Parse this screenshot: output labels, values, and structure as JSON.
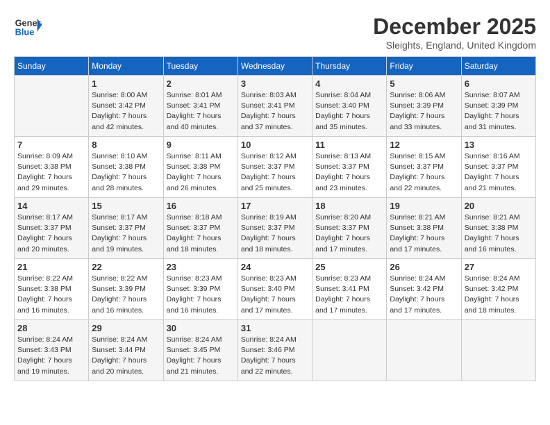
{
  "header": {
    "logo_general": "General",
    "logo_blue": "Blue",
    "month_title": "December 2025",
    "location": "Sleights, England, United Kingdom"
  },
  "days_of_week": [
    "Sunday",
    "Monday",
    "Tuesday",
    "Wednesday",
    "Thursday",
    "Friday",
    "Saturday"
  ],
  "weeks": [
    {
      "days": [
        {
          "number": "",
          "sunrise": "",
          "sunset": "",
          "daylight": ""
        },
        {
          "number": "1",
          "sunrise": "Sunrise: 8:00 AM",
          "sunset": "Sunset: 3:42 PM",
          "daylight": "Daylight: 7 hours and 42 minutes."
        },
        {
          "number": "2",
          "sunrise": "Sunrise: 8:01 AM",
          "sunset": "Sunset: 3:41 PM",
          "daylight": "Daylight: 7 hours and 40 minutes."
        },
        {
          "number": "3",
          "sunrise": "Sunrise: 8:03 AM",
          "sunset": "Sunset: 3:41 PM",
          "daylight": "Daylight: 7 hours and 37 minutes."
        },
        {
          "number": "4",
          "sunrise": "Sunrise: 8:04 AM",
          "sunset": "Sunset: 3:40 PM",
          "daylight": "Daylight: 7 hours and 35 minutes."
        },
        {
          "number": "5",
          "sunrise": "Sunrise: 8:06 AM",
          "sunset": "Sunset: 3:39 PM",
          "daylight": "Daylight: 7 hours and 33 minutes."
        },
        {
          "number": "6",
          "sunrise": "Sunrise: 8:07 AM",
          "sunset": "Sunset: 3:39 PM",
          "daylight": "Daylight: 7 hours and 31 minutes."
        }
      ]
    },
    {
      "days": [
        {
          "number": "7",
          "sunrise": "Sunrise: 8:09 AM",
          "sunset": "Sunset: 3:38 PM",
          "daylight": "Daylight: 7 hours and 29 minutes."
        },
        {
          "number": "8",
          "sunrise": "Sunrise: 8:10 AM",
          "sunset": "Sunset: 3:38 PM",
          "daylight": "Daylight: 7 hours and 28 minutes."
        },
        {
          "number": "9",
          "sunrise": "Sunrise: 8:11 AM",
          "sunset": "Sunset: 3:38 PM",
          "daylight": "Daylight: 7 hours and 26 minutes."
        },
        {
          "number": "10",
          "sunrise": "Sunrise: 8:12 AM",
          "sunset": "Sunset: 3:37 PM",
          "daylight": "Daylight: 7 hours and 25 minutes."
        },
        {
          "number": "11",
          "sunrise": "Sunrise: 8:13 AM",
          "sunset": "Sunset: 3:37 PM",
          "daylight": "Daylight: 7 hours and 23 minutes."
        },
        {
          "number": "12",
          "sunrise": "Sunrise: 8:15 AM",
          "sunset": "Sunset: 3:37 PM",
          "daylight": "Daylight: 7 hours and 22 minutes."
        },
        {
          "number": "13",
          "sunrise": "Sunrise: 8:16 AM",
          "sunset": "Sunset: 3:37 PM",
          "daylight": "Daylight: 7 hours and 21 minutes."
        }
      ]
    },
    {
      "days": [
        {
          "number": "14",
          "sunrise": "Sunrise: 8:17 AM",
          "sunset": "Sunset: 3:37 PM",
          "daylight": "Daylight: 7 hours and 20 minutes."
        },
        {
          "number": "15",
          "sunrise": "Sunrise: 8:17 AM",
          "sunset": "Sunset: 3:37 PM",
          "daylight": "Daylight: 7 hours and 19 minutes."
        },
        {
          "number": "16",
          "sunrise": "Sunrise: 8:18 AM",
          "sunset": "Sunset: 3:37 PM",
          "daylight": "Daylight: 7 hours and 18 minutes."
        },
        {
          "number": "17",
          "sunrise": "Sunrise: 8:19 AM",
          "sunset": "Sunset: 3:37 PM",
          "daylight": "Daylight: 7 hours and 18 minutes."
        },
        {
          "number": "18",
          "sunrise": "Sunrise: 8:20 AM",
          "sunset": "Sunset: 3:37 PM",
          "daylight": "Daylight: 7 hours and 17 minutes."
        },
        {
          "number": "19",
          "sunrise": "Sunrise: 8:21 AM",
          "sunset": "Sunset: 3:38 PM",
          "daylight": "Daylight: 7 hours and 17 minutes."
        },
        {
          "number": "20",
          "sunrise": "Sunrise: 8:21 AM",
          "sunset": "Sunset: 3:38 PM",
          "daylight": "Daylight: 7 hours and 16 minutes."
        }
      ]
    },
    {
      "days": [
        {
          "number": "21",
          "sunrise": "Sunrise: 8:22 AM",
          "sunset": "Sunset: 3:38 PM",
          "daylight": "Daylight: 7 hours and 16 minutes."
        },
        {
          "number": "22",
          "sunrise": "Sunrise: 8:22 AM",
          "sunset": "Sunset: 3:39 PM",
          "daylight": "Daylight: 7 hours and 16 minutes."
        },
        {
          "number": "23",
          "sunrise": "Sunrise: 8:23 AM",
          "sunset": "Sunset: 3:39 PM",
          "daylight": "Daylight: 7 hours and 16 minutes."
        },
        {
          "number": "24",
          "sunrise": "Sunrise: 8:23 AM",
          "sunset": "Sunset: 3:40 PM",
          "daylight": "Daylight: 7 hours and 17 minutes."
        },
        {
          "number": "25",
          "sunrise": "Sunrise: 8:23 AM",
          "sunset": "Sunset: 3:41 PM",
          "daylight": "Daylight: 7 hours and 17 minutes."
        },
        {
          "number": "26",
          "sunrise": "Sunrise: 8:24 AM",
          "sunset": "Sunset: 3:42 PM",
          "daylight": "Daylight: 7 hours and 17 minutes."
        },
        {
          "number": "27",
          "sunrise": "Sunrise: 8:24 AM",
          "sunset": "Sunset: 3:42 PM",
          "daylight": "Daylight: 7 hours and 18 minutes."
        }
      ]
    },
    {
      "days": [
        {
          "number": "28",
          "sunrise": "Sunrise: 8:24 AM",
          "sunset": "Sunset: 3:43 PM",
          "daylight": "Daylight: 7 hours and 19 minutes."
        },
        {
          "number": "29",
          "sunrise": "Sunrise: 8:24 AM",
          "sunset": "Sunset: 3:44 PM",
          "daylight": "Daylight: 7 hours and 20 minutes."
        },
        {
          "number": "30",
          "sunrise": "Sunrise: 8:24 AM",
          "sunset": "Sunset: 3:45 PM",
          "daylight": "Daylight: 7 hours and 21 minutes."
        },
        {
          "number": "31",
          "sunrise": "Sunrise: 8:24 AM",
          "sunset": "Sunset: 3:46 PM",
          "daylight": "Daylight: 7 hours and 22 minutes."
        },
        {
          "number": "",
          "sunrise": "",
          "sunset": "",
          "daylight": ""
        },
        {
          "number": "",
          "sunrise": "",
          "sunset": "",
          "daylight": ""
        },
        {
          "number": "",
          "sunrise": "",
          "sunset": "",
          "daylight": ""
        }
      ]
    }
  ]
}
